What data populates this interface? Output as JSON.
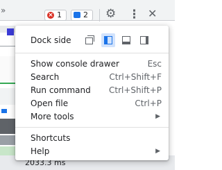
{
  "toolbar": {
    "error_count": "1",
    "message_count": "2"
  },
  "timeline": {
    "bottom_label": "2033.3 ms"
  },
  "menu": {
    "dock_side_label": "Dock side",
    "dock_options": [
      {
        "name": "undock-into-separate-window-icon",
        "selected": false
      },
      {
        "name": "dock-to-left-icon",
        "selected": true
      },
      {
        "name": "dock-to-bottom-icon",
        "selected": false
      },
      {
        "name": "dock-to-right-icon",
        "selected": false
      }
    ],
    "items": [
      {
        "label": "Show console drawer",
        "shortcut": "Esc"
      },
      {
        "label": "Search",
        "shortcut": "Ctrl+Shift+F"
      },
      {
        "label": "Run command",
        "shortcut": "Ctrl+Shift+P"
      },
      {
        "label": "Open file",
        "shortcut": "Ctrl+P"
      },
      {
        "label": "More tools",
        "submenu": true
      },
      {
        "label": "Shortcuts"
      },
      {
        "label": "Help",
        "submenu": true
      }
    ],
    "accent_color": "#1a73e8"
  }
}
